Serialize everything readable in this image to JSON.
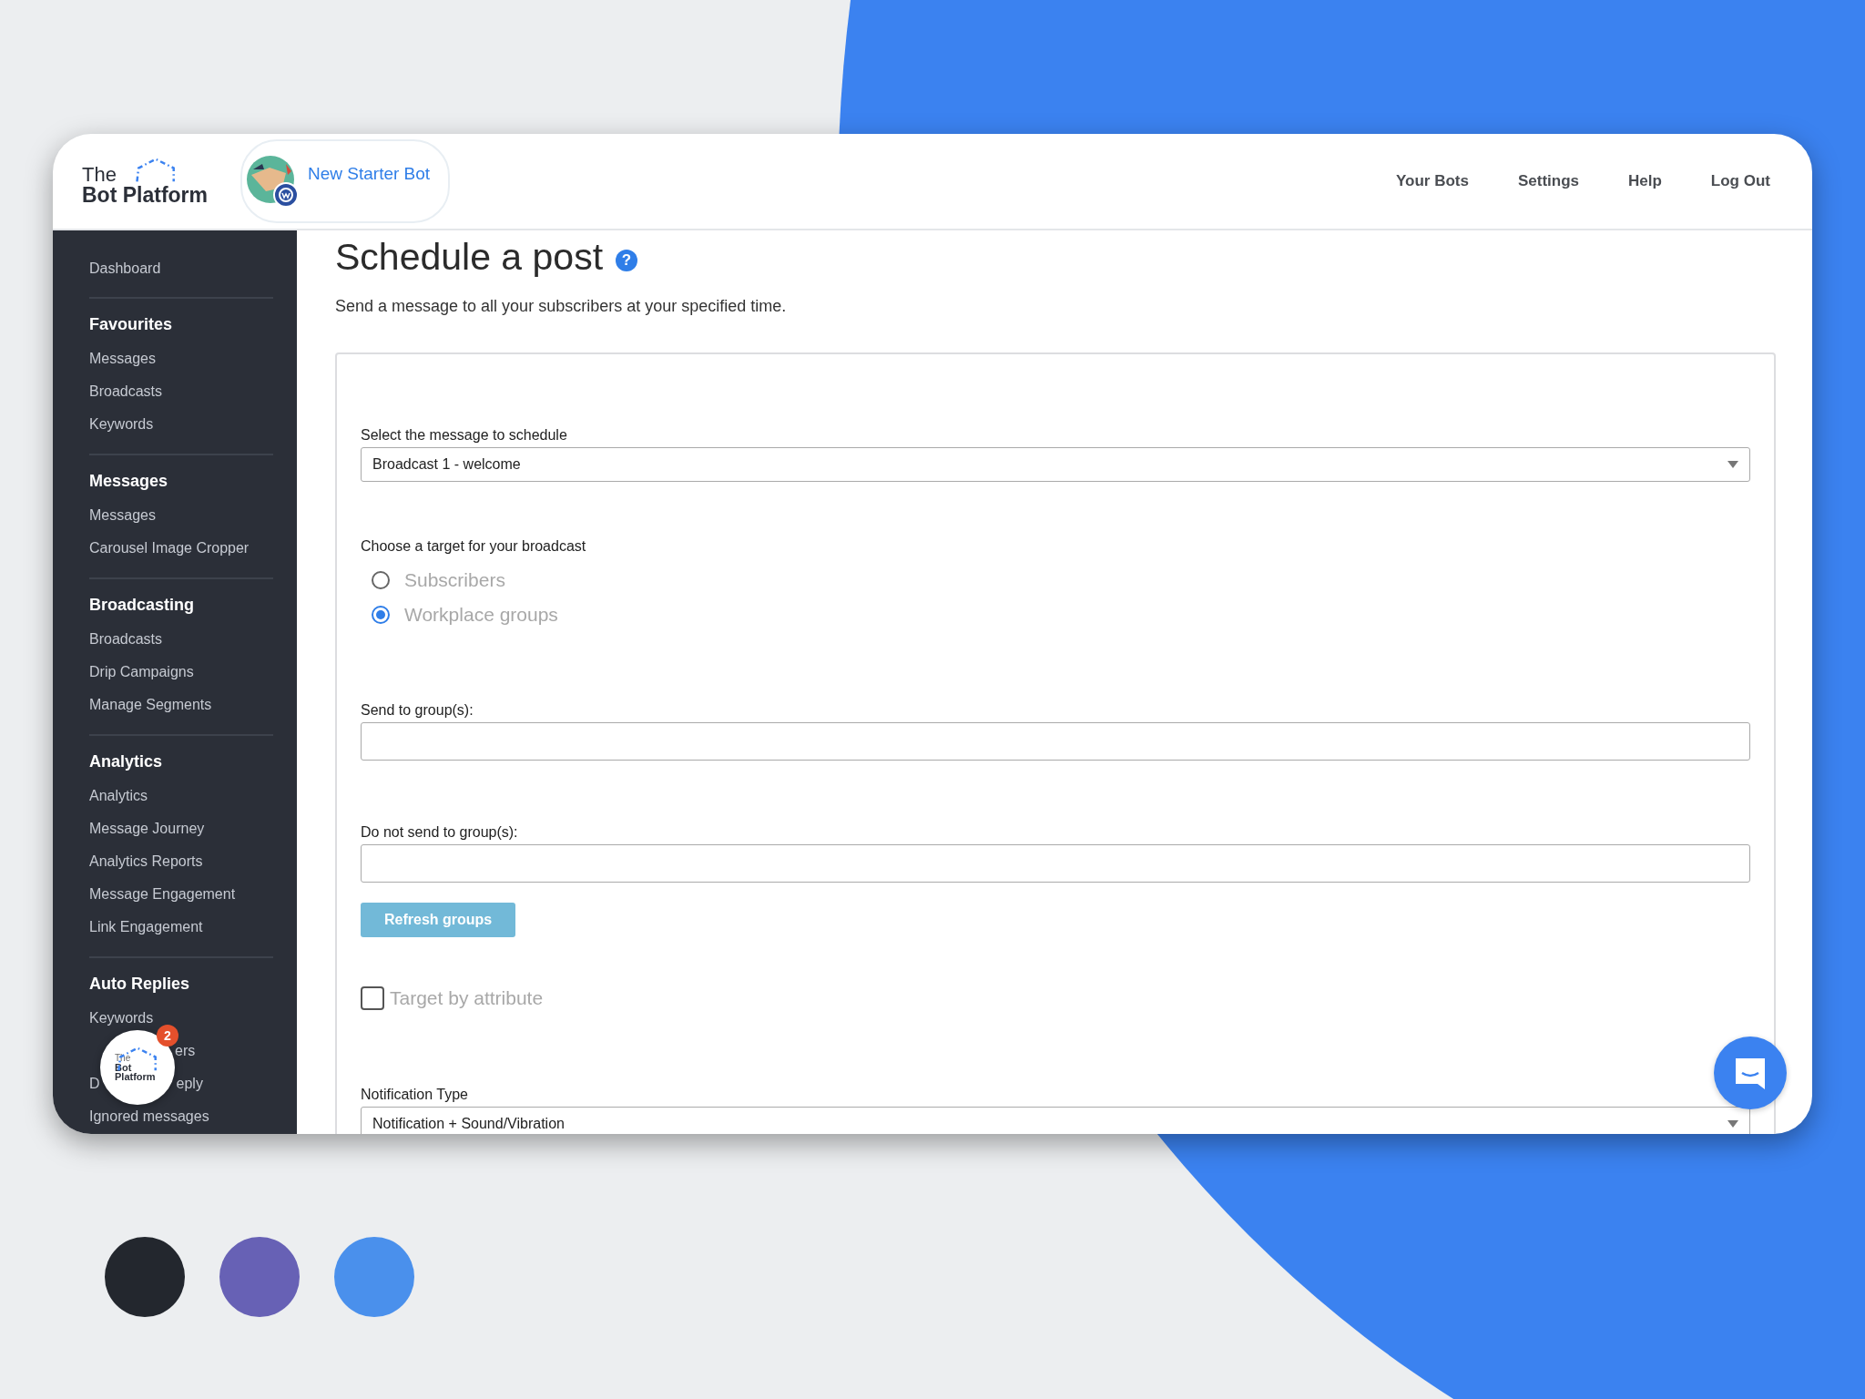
{
  "header": {
    "logo_top": "The",
    "logo_bottom": "Bot Platform",
    "bot_name": "New Starter Bot",
    "nav": [
      "Your Bots",
      "Settings",
      "Help",
      "Log Out"
    ]
  },
  "sidebar": {
    "sections": [
      {
        "items": [
          {
            "label": "Dashboard"
          }
        ]
      },
      {
        "heading": "Favourites",
        "items": [
          {
            "label": "Messages"
          },
          {
            "label": "Broadcasts"
          },
          {
            "label": "Keywords"
          }
        ]
      },
      {
        "heading": "Messages",
        "items": [
          {
            "label": "Messages"
          },
          {
            "label": "Carousel Image Cropper"
          }
        ]
      },
      {
        "heading": "Broadcasting",
        "items": [
          {
            "label": "Broadcasts"
          },
          {
            "label": "Drip Campaigns"
          },
          {
            "label": "Manage Segments"
          }
        ]
      },
      {
        "heading": "Analytics",
        "items": [
          {
            "label": "Analytics"
          },
          {
            "label": "Message Journey"
          },
          {
            "label": "Analytics Reports"
          },
          {
            "label": "Message Engagement"
          },
          {
            "label": "Link Engagement"
          }
        ]
      },
      {
        "heading": "Auto Replies",
        "items": [
          {
            "label": "Keywords"
          },
          {
            "kind": "covered",
            "parts": [
              "ers"
            ]
          },
          {
            "kind": "covered",
            "parts": [
              "D",
              "eply"
            ]
          },
          {
            "label": "Ignored messages"
          }
        ]
      }
    ]
  },
  "page": {
    "title": "Schedule a post",
    "help_icon": "?",
    "subtitle": "Send a message to all your subscribers at your specified time."
  },
  "form": {
    "message_label": "Select the message to schedule",
    "message_value": "Broadcast 1 - welcome",
    "target_label": "Choose a target for your broadcast",
    "targets": [
      {
        "label": "Subscribers",
        "selected": false
      },
      {
        "label": "Workplace groups",
        "selected": true
      }
    ],
    "send_label": "Send to group(s):",
    "exclude_label": "Do not send to group(s):",
    "refresh_button": "Refresh groups",
    "attribute": {
      "label": "Target by attribute",
      "checked": false
    },
    "notification_label": "Notification Type",
    "notification_value": "Notification + Sound/Vibration"
  },
  "widget": {
    "logo_top": "The",
    "logo_middle": "Bot",
    "logo_bottom": "Platform",
    "badge": "2"
  },
  "swatches": [
    {
      "color": "#23272e"
    },
    {
      "color": "#6761b5"
    },
    {
      "color": "#4a90ec"
    }
  ]
}
